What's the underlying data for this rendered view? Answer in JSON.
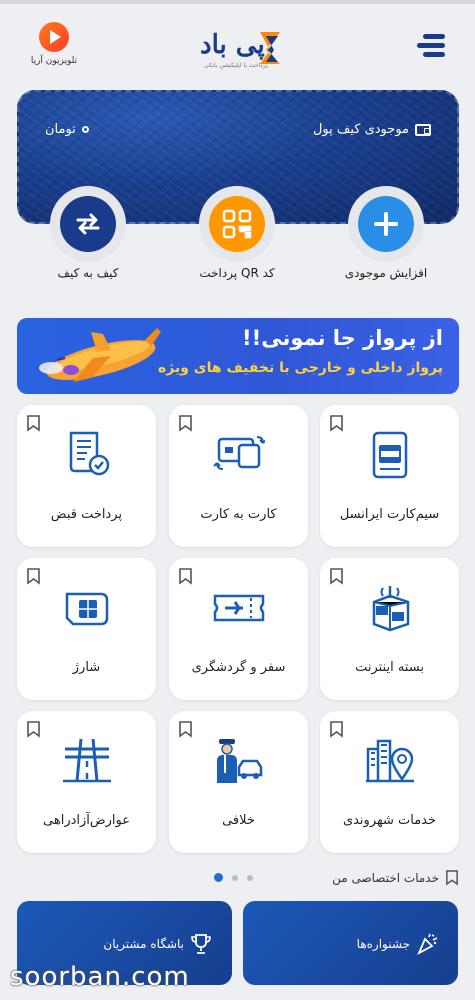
{
  "header": {
    "tv_logo_label": "تلویزیون آریا",
    "brand_name": "پی باد",
    "brand_tagline": "پرداخت با اپلیکیشن بانکی"
  },
  "wallet": {
    "label": "موجودی کیف پول",
    "balance": "تومان",
    "card_color": "#1a3f8f"
  },
  "actions": [
    {
      "label": "افزایش موجودی",
      "icon": "plus-icon",
      "color": "#2a8ee6"
    },
    {
      "label": "پرداخت QR کد",
      "icon": "qr-code-icon",
      "color": "#ff9800"
    },
    {
      "label": "کیف به کیف",
      "icon": "transfer-arrows-icon",
      "color": "#1a3a8c"
    }
  ],
  "banner": {
    "title": "از پرواز جا نمونی!!",
    "subtitle": "پرواز داخلی و خارجی با تخفیف های ویژه"
  },
  "services": [
    {
      "label": "سیم‌کارت ایرانسل",
      "icon": "sim-card-irancell-icon"
    },
    {
      "label": "کارت به کارت",
      "icon": "card-transfer-icon"
    },
    {
      "label": "پرداخت قبض",
      "icon": "bill-icon"
    },
    {
      "label": "بسته اینترنت",
      "icon": "internet-package-icon"
    },
    {
      "label": "سفر و گردشگری",
      "icon": "flight-ticket-icon"
    },
    {
      "label": "شارژ",
      "icon": "sim-charge-icon"
    },
    {
      "label": "خدمات شهروندی",
      "icon": "city-location-icon"
    },
    {
      "label": "خلافی",
      "icon": "traffic-police-icon"
    },
    {
      "label": "عوارض‌آزادراهی",
      "icon": "highway-toll-icon"
    }
  ],
  "exclusive": {
    "label": "خدمات اختصاصی من"
  },
  "pager": {
    "active_page": 1,
    "page_count": 3
  },
  "bottom_cards": [
    {
      "label": "جشنواره‌ها",
      "icon": "party-popper-icon"
    },
    {
      "label": "باشگاه مشتریان",
      "icon": "trophy-icon"
    }
  ],
  "watermark": "soorban.com",
  "colors": {
    "primary": "#1a3a8c",
    "accent_blue": "#2a8ee6",
    "accent_orange": "#ff9800",
    "banner": "#2f57d6"
  }
}
